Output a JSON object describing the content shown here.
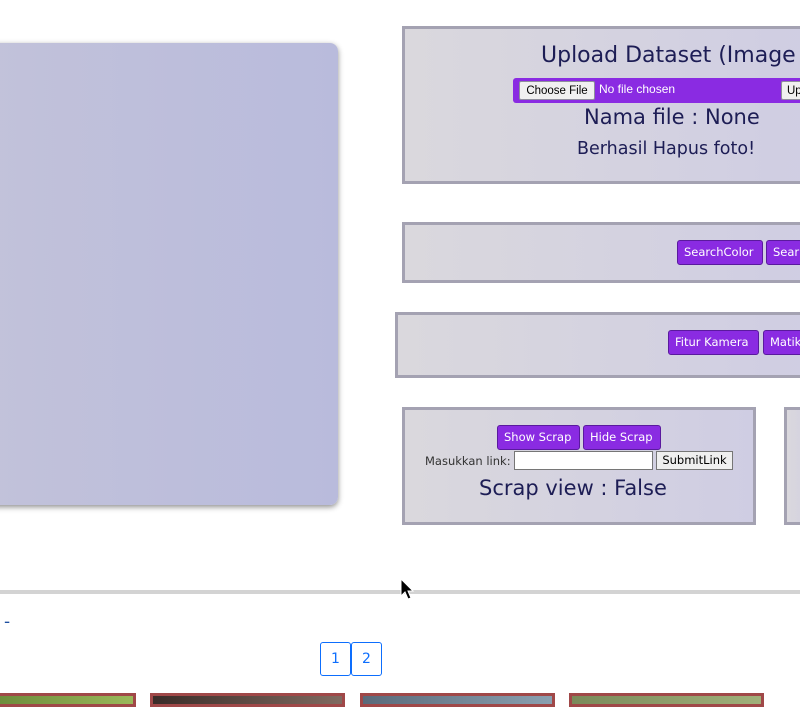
{
  "upload": {
    "title": "Upload Dataset (Image",
    "choose_file": "Choose File",
    "no_file": "No file chosen",
    "upload_button": "Up",
    "file_name": "Nama file : None",
    "status": "Berhasil Hapus foto!"
  },
  "search": {
    "search_color": "SearchColor",
    "search_other": "Sear"
  },
  "camera": {
    "fitur_kamera": "Fitur Kamera",
    "matikan": "Matik"
  },
  "scrap": {
    "show": "Show Scrap",
    "hide": "Hide Scrap",
    "link_label": "Masukkan link:",
    "link_value": "",
    "submit": "SubmitLink",
    "view_status": "Scrap view : False"
  },
  "dash_text": "-",
  "pagination": [
    "1",
    "2"
  ],
  "colors": {
    "button": "#8a2be2",
    "panel_border": "#a4a2b2",
    "page_link": "#0d6efd"
  }
}
